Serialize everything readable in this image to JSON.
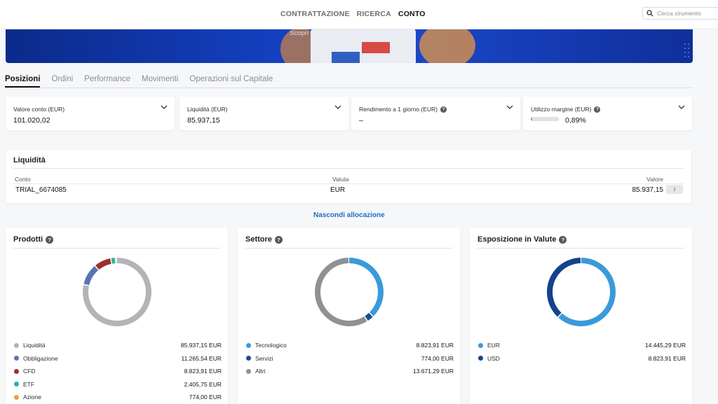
{
  "nav": {
    "links": [
      "CONTRATTAZIONE",
      "RICERCA",
      "CONTO"
    ],
    "active": "CONTO",
    "search_placeholder": "Cerca strumento"
  },
  "banner": {
    "caption": "Scopri le nuove commissioni di BG SAXO"
  },
  "tabs": [
    "Posizioni",
    "Ordini",
    "Performance",
    "Movimenti",
    "Operazioni sul Capitale"
  ],
  "metrics": [
    {
      "label": "Valore conto (EUR)",
      "value": "101.020,02"
    },
    {
      "label": "Liquidità (EUR)",
      "value": "85.937,15"
    },
    {
      "label": "Rendimento a 1 giorno (EUR)",
      "value": "–"
    },
    {
      "label": "Utilizzo margine (EUR)",
      "value": "0,89%",
      "bar_fraction": 0.0089
    }
  ],
  "liquidity": {
    "title": "Liquidità",
    "headers": {
      "account": "Conto",
      "currency": "Valuta",
      "value": "Valore"
    },
    "row": {
      "account": "TRIAL_6674085",
      "currency": "EUR",
      "value": "85.937,15"
    },
    "info": "i"
  },
  "toggle_label": "Nascondi allocazione",
  "allocations": [
    {
      "title": "Prodotti",
      "items": [
        {
          "name": "Liquidità",
          "amount": "85.937,15 EUR",
          "value": 85937.15,
          "color": "#b3b4b8"
        },
        {
          "name": "Obbligazione",
          "amount": "11.265,54 EUR",
          "value": 11265.54,
          "color": "#5b73b3"
        },
        {
          "name": "CFD",
          "amount": "8.823,91 EUR",
          "value": 8823.91,
          "color": "#9b2f2c"
        },
        {
          "name": "ETF",
          "amount": "2.405,75 EUR",
          "value": 2405.75,
          "color": "#2ab3a8"
        },
        {
          "name": "Azione",
          "amount": "774,00 EUR",
          "value": 774.0,
          "color": "#e8a43a"
        }
      ]
    },
    {
      "title": "Settore",
      "items": [
        {
          "name": "Tecnologico",
          "amount": "8.823,91 EUR",
          "value": 8823.91,
          "color": "#3a9ad9"
        },
        {
          "name": "Servizi",
          "amount": "774,00 EUR",
          "value": 774.0,
          "color": "#1c4d8f"
        },
        {
          "name": "Altri",
          "amount": "13.671,29 EUR",
          "value": 13671.29,
          "color": "#8f9195"
        }
      ]
    },
    {
      "title": "Esposizione in Valute",
      "items": [
        {
          "name": "EUR",
          "amount": "14.445,29 EUR",
          "value": 14445.29,
          "color": "#3a9ad9"
        },
        {
          "name": "USD",
          "amount": "8.823,91 EUR",
          "value": 8823.91,
          "color": "#14438c"
        }
      ]
    }
  ]
}
